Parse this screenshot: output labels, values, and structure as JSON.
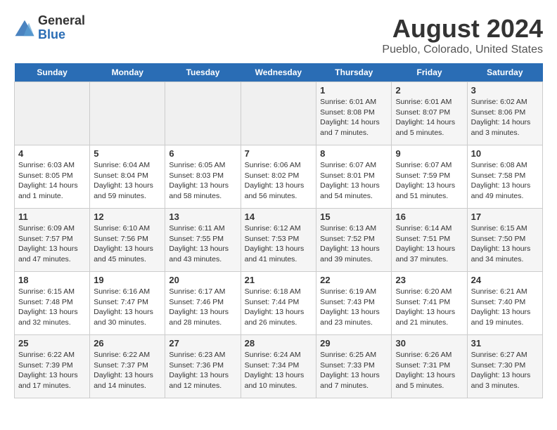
{
  "header": {
    "logo_general": "General",
    "logo_blue": "Blue",
    "title": "August 2024",
    "subtitle": "Pueblo, Colorado, United States"
  },
  "days_of_week": [
    "Sunday",
    "Monday",
    "Tuesday",
    "Wednesday",
    "Thursday",
    "Friday",
    "Saturday"
  ],
  "weeks": [
    [
      {
        "date": "",
        "content": ""
      },
      {
        "date": "",
        "content": ""
      },
      {
        "date": "",
        "content": ""
      },
      {
        "date": "",
        "content": ""
      },
      {
        "date": "1",
        "content": "Sunrise: 6:01 AM\nSunset: 8:08 PM\nDaylight: 14 hours and 7 minutes."
      },
      {
        "date": "2",
        "content": "Sunrise: 6:01 AM\nSunset: 8:07 PM\nDaylight: 14 hours and 5 minutes."
      },
      {
        "date": "3",
        "content": "Sunrise: 6:02 AM\nSunset: 8:06 PM\nDaylight: 14 hours and 3 minutes."
      }
    ],
    [
      {
        "date": "4",
        "content": "Sunrise: 6:03 AM\nSunset: 8:05 PM\nDaylight: 14 hours and 1 minute."
      },
      {
        "date": "5",
        "content": "Sunrise: 6:04 AM\nSunset: 8:04 PM\nDaylight: 13 hours and 59 minutes."
      },
      {
        "date": "6",
        "content": "Sunrise: 6:05 AM\nSunset: 8:03 PM\nDaylight: 13 hours and 58 minutes."
      },
      {
        "date": "7",
        "content": "Sunrise: 6:06 AM\nSunset: 8:02 PM\nDaylight: 13 hours and 56 minutes."
      },
      {
        "date": "8",
        "content": "Sunrise: 6:07 AM\nSunset: 8:01 PM\nDaylight: 13 hours and 54 minutes."
      },
      {
        "date": "9",
        "content": "Sunrise: 6:07 AM\nSunset: 7:59 PM\nDaylight: 13 hours and 51 minutes."
      },
      {
        "date": "10",
        "content": "Sunrise: 6:08 AM\nSunset: 7:58 PM\nDaylight: 13 hours and 49 minutes."
      }
    ],
    [
      {
        "date": "11",
        "content": "Sunrise: 6:09 AM\nSunset: 7:57 PM\nDaylight: 13 hours and 47 minutes."
      },
      {
        "date": "12",
        "content": "Sunrise: 6:10 AM\nSunset: 7:56 PM\nDaylight: 13 hours and 45 minutes."
      },
      {
        "date": "13",
        "content": "Sunrise: 6:11 AM\nSunset: 7:55 PM\nDaylight: 13 hours and 43 minutes."
      },
      {
        "date": "14",
        "content": "Sunrise: 6:12 AM\nSunset: 7:53 PM\nDaylight: 13 hours and 41 minutes."
      },
      {
        "date": "15",
        "content": "Sunrise: 6:13 AM\nSunset: 7:52 PM\nDaylight: 13 hours and 39 minutes."
      },
      {
        "date": "16",
        "content": "Sunrise: 6:14 AM\nSunset: 7:51 PM\nDaylight: 13 hours and 37 minutes."
      },
      {
        "date": "17",
        "content": "Sunrise: 6:15 AM\nSunset: 7:50 PM\nDaylight: 13 hours and 34 minutes."
      }
    ],
    [
      {
        "date": "18",
        "content": "Sunrise: 6:15 AM\nSunset: 7:48 PM\nDaylight: 13 hours and 32 minutes."
      },
      {
        "date": "19",
        "content": "Sunrise: 6:16 AM\nSunset: 7:47 PM\nDaylight: 13 hours and 30 minutes."
      },
      {
        "date": "20",
        "content": "Sunrise: 6:17 AM\nSunset: 7:46 PM\nDaylight: 13 hours and 28 minutes."
      },
      {
        "date": "21",
        "content": "Sunrise: 6:18 AM\nSunset: 7:44 PM\nDaylight: 13 hours and 26 minutes."
      },
      {
        "date": "22",
        "content": "Sunrise: 6:19 AM\nSunset: 7:43 PM\nDaylight: 13 hours and 23 minutes."
      },
      {
        "date": "23",
        "content": "Sunrise: 6:20 AM\nSunset: 7:41 PM\nDaylight: 13 hours and 21 minutes."
      },
      {
        "date": "24",
        "content": "Sunrise: 6:21 AM\nSunset: 7:40 PM\nDaylight: 13 hours and 19 minutes."
      }
    ],
    [
      {
        "date": "25",
        "content": "Sunrise: 6:22 AM\nSunset: 7:39 PM\nDaylight: 13 hours and 17 minutes."
      },
      {
        "date": "26",
        "content": "Sunrise: 6:22 AM\nSunset: 7:37 PM\nDaylight: 13 hours and 14 minutes."
      },
      {
        "date": "27",
        "content": "Sunrise: 6:23 AM\nSunset: 7:36 PM\nDaylight: 13 hours and 12 minutes."
      },
      {
        "date": "28",
        "content": "Sunrise: 6:24 AM\nSunset: 7:34 PM\nDaylight: 13 hours and 10 minutes."
      },
      {
        "date": "29",
        "content": "Sunrise: 6:25 AM\nSunset: 7:33 PM\nDaylight: 13 hours and 7 minutes."
      },
      {
        "date": "30",
        "content": "Sunrise: 6:26 AM\nSunset: 7:31 PM\nDaylight: 13 hours and 5 minutes."
      },
      {
        "date": "31",
        "content": "Sunrise: 6:27 AM\nSunset: 7:30 PM\nDaylight: 13 hours and 3 minutes."
      }
    ]
  ]
}
